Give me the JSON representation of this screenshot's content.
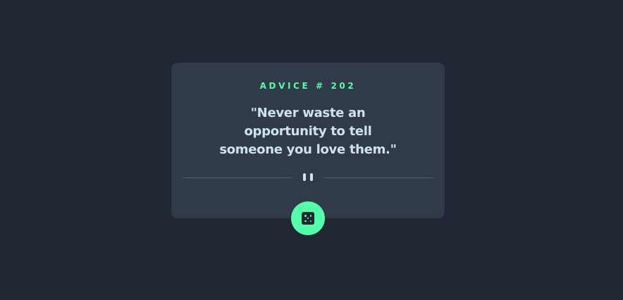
{
  "advice": {
    "id_label": "ADVICE # 202",
    "quote": "\"Never waste an opportunity to tell someone you love them.\""
  },
  "icons": {
    "divider": "pause-icon",
    "button": "dice-icon"
  },
  "colors": {
    "background": "#202632",
    "card": "#313a49",
    "accent": "#52ffa8",
    "text": "#cee3e9",
    "divider": "#4f5d74"
  }
}
